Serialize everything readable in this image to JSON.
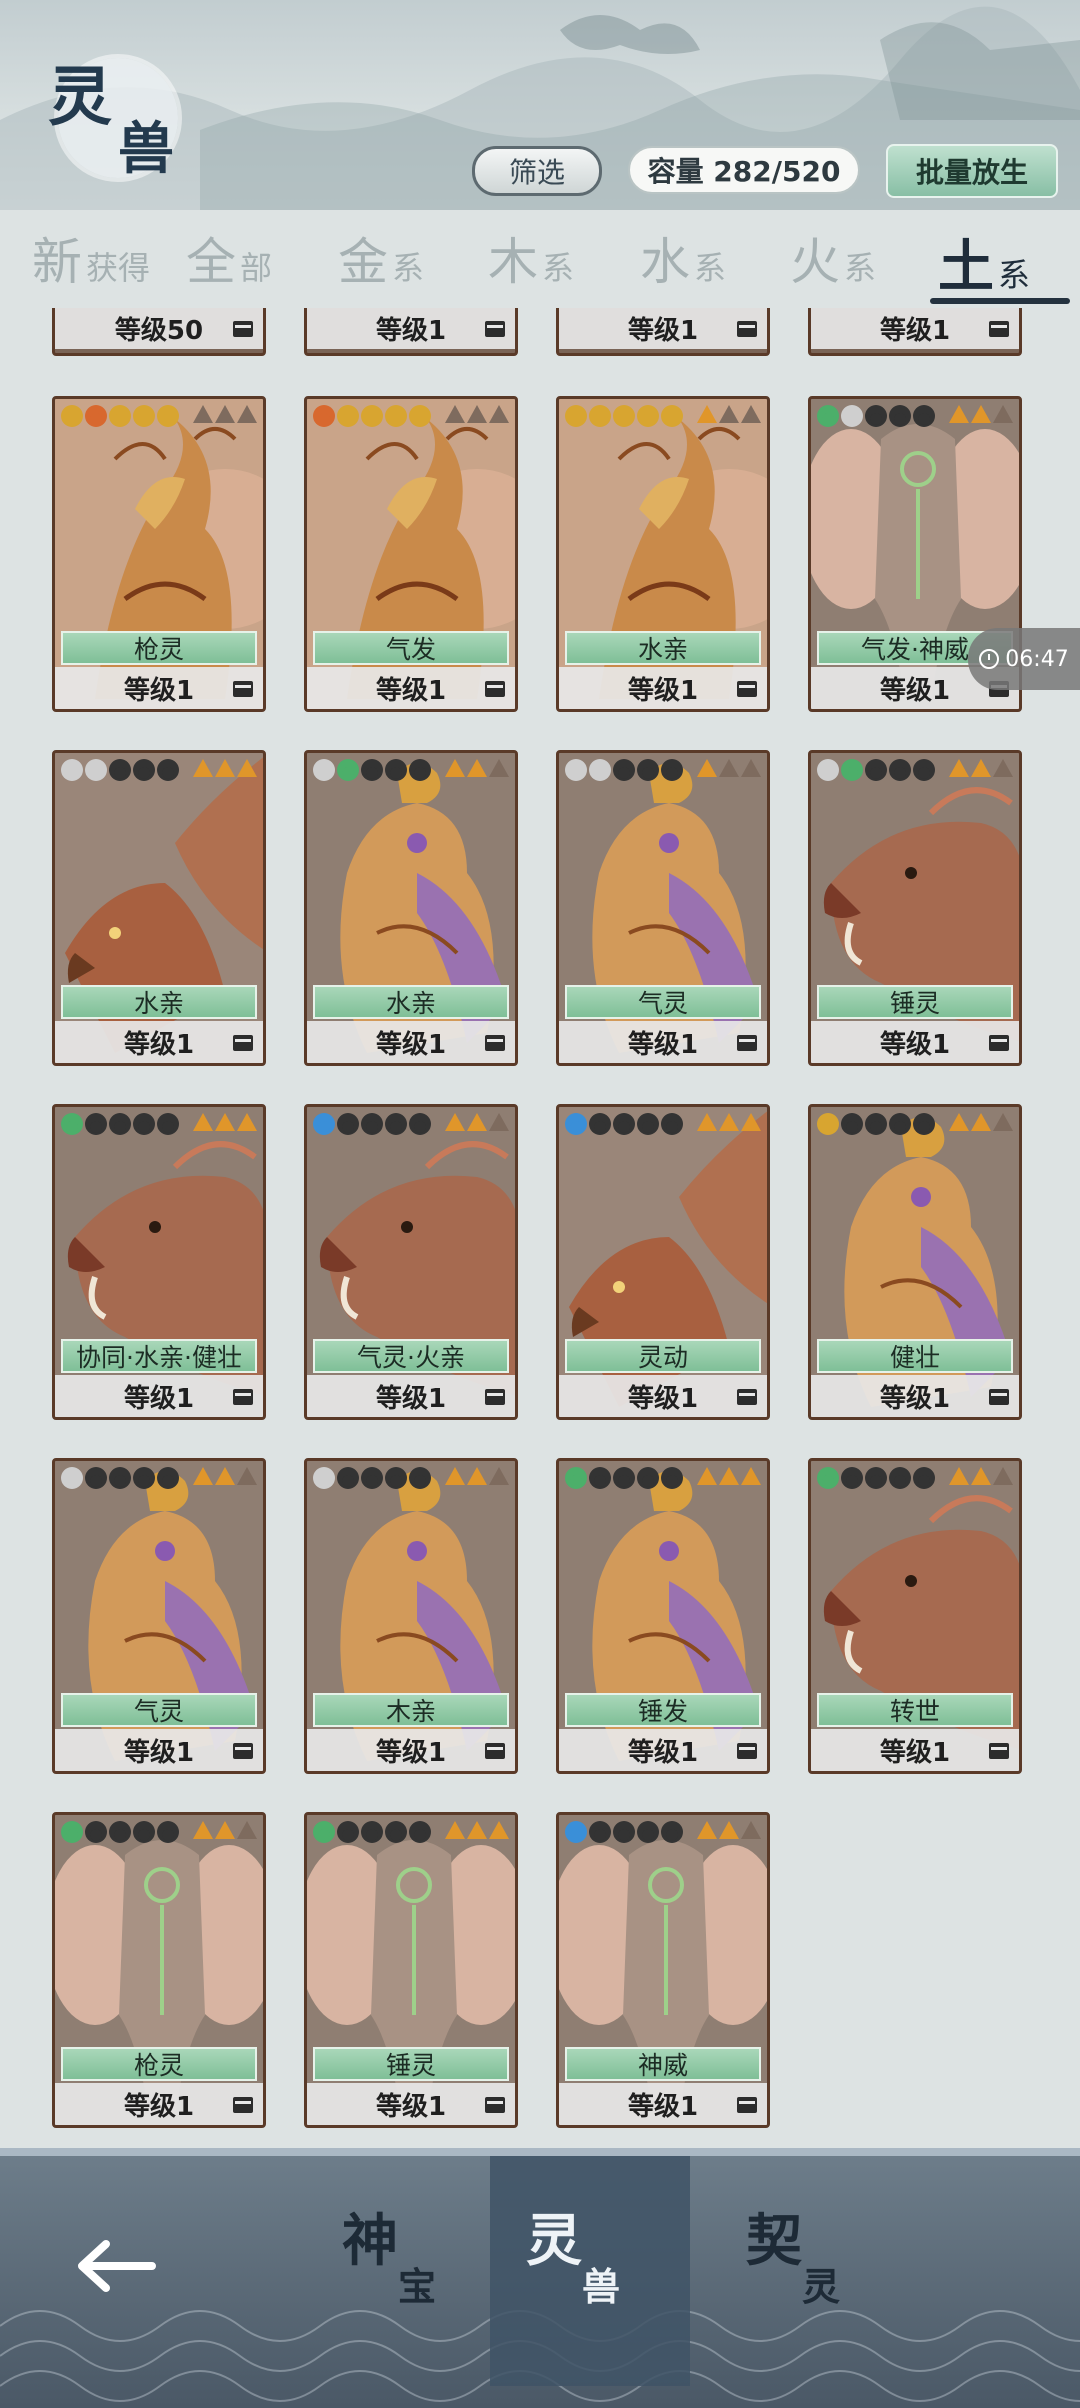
{
  "header": {
    "logo_char1": "灵",
    "logo_char2": "兽",
    "filter_label": "筛选",
    "capacity_label": "容量 282/520",
    "release_label": "批量放生"
  },
  "tabs": [
    {
      "big": "新",
      "small": "获得"
    },
    {
      "big": "全",
      "small": "部"
    },
    {
      "big": "金",
      "small": "系"
    },
    {
      "big": "木",
      "small": "系"
    },
    {
      "big": "水",
      "small": "系"
    },
    {
      "big": "火",
      "small": "系"
    },
    {
      "big": "土",
      "small": "系",
      "active": true
    }
  ],
  "top_partial_levels": [
    "等级50",
    "等级1",
    "等级1",
    "等级1"
  ],
  "cards": [
    {
      "creature": "dragon",
      "trait": "枪灵",
      "level": "等级1",
      "paws": [
        "#d8a530",
        "#d8682e",
        "#d8a530",
        "#d8a530",
        "#d8a530"
      ],
      "tris": 0
    },
    {
      "creature": "dragon",
      "trait": "气发",
      "level": "等级1",
      "paws": [
        "#d8682e",
        "#d8a530",
        "#d8a530",
        "#d8a530",
        "#d8a530"
      ],
      "tris": 0
    },
    {
      "creature": "dragon",
      "trait": "水亲",
      "level": "等级1",
      "paws": [
        "#d8a530",
        "#d8a530",
        "#d8a530",
        "#d8a530",
        "#d8a530"
      ],
      "tris": 1
    },
    {
      "creature": "elephant",
      "trait": "气发·神威",
      "level": "等级1",
      "paws": [
        "#4caf6a",
        "#cfcfcf",
        "#333",
        "#333",
        "#333"
      ],
      "tris": 2
    },
    {
      "creature": "eagle",
      "trait": "水亲",
      "level": "等级1",
      "paws": [
        "#cfcfcf",
        "#cfcfcf",
        "#333",
        "#333",
        "#333"
      ],
      "tris": 3
    },
    {
      "creature": "rooster",
      "trait": "水亲",
      "level": "等级1",
      "paws": [
        "#cfcfcf",
        "#4caf6a",
        "#333",
        "#333",
        "#333"
      ],
      "tris": 2
    },
    {
      "creature": "rooster",
      "trait": "气灵",
      "level": "等级1",
      "paws": [
        "#cfcfcf",
        "#cfcfcf",
        "#333",
        "#333",
        "#333"
      ],
      "tris": 1
    },
    {
      "creature": "boar",
      "trait": "锤灵",
      "level": "等级1",
      "paws": [
        "#cfcfcf",
        "#4caf6a",
        "#333",
        "#333",
        "#333"
      ],
      "tris": 2
    },
    {
      "creature": "boar",
      "trait": "协同·水亲·健壮",
      "level": "等级1",
      "paws": [
        "#4caf6a",
        "#333",
        "#333",
        "#333",
        "#333"
      ],
      "tris": 3
    },
    {
      "creature": "boar",
      "trait": "气灵·火亲",
      "level": "等级1",
      "paws": [
        "#3a8fd8",
        "#333",
        "#333",
        "#333",
        "#333"
      ],
      "tris": 2
    },
    {
      "creature": "eagle",
      "trait": "灵动",
      "level": "等级1",
      "paws": [
        "#3a8fd8",
        "#333",
        "#333",
        "#333",
        "#333"
      ],
      "tris": 3
    },
    {
      "creature": "rooster",
      "trait": "健壮",
      "level": "等级1",
      "paws": [
        "#d8a530",
        "#333",
        "#333",
        "#333",
        "#333"
      ],
      "tris": 2
    },
    {
      "creature": "rooster",
      "trait": "气灵",
      "level": "等级1",
      "paws": [
        "#cfcfcf",
        "#333",
        "#333",
        "#333",
        "#333"
      ],
      "tris": 2
    },
    {
      "creature": "rooster",
      "trait": "木亲",
      "level": "等级1",
      "paws": [
        "#cfcfcf",
        "#333",
        "#333",
        "#333",
        "#333"
      ],
      "tris": 2
    },
    {
      "creature": "rooster",
      "trait": "锤发",
      "level": "等级1",
      "paws": [
        "#4caf6a",
        "#333",
        "#333",
        "#333",
        "#333"
      ],
      "tris": 3
    },
    {
      "creature": "boar",
      "trait": "转世",
      "level": "等级1",
      "paws": [
        "#4caf6a",
        "#333",
        "#333",
        "#333",
        "#333"
      ],
      "tris": 2
    },
    {
      "creature": "elephant",
      "trait": "枪灵",
      "level": "等级1",
      "paws": [
        "#4caf6a",
        "#333",
        "#333",
        "#333",
        "#333"
      ],
      "tris": 2
    },
    {
      "creature": "elephant",
      "trait": "锤灵",
      "level": "等级1",
      "paws": [
        "#4caf6a",
        "#333",
        "#333",
        "#333",
        "#333"
      ],
      "tris": 3
    },
    {
      "creature": "elephant",
      "trait": "神威",
      "level": "等级1",
      "paws": [
        "#3a8fd8",
        "#333",
        "#333",
        "#333",
        "#333"
      ],
      "tris": 2
    }
  ],
  "time_bubble": "06:47",
  "bottom_nav": [
    {
      "big": "神",
      "small": "宝"
    },
    {
      "big": "灵",
      "small": "兽",
      "active": true
    },
    {
      "big": "契",
      "small": "灵"
    }
  ],
  "icons": {
    "back": "left-arrow-icon",
    "clock": "clock-icon",
    "lock": "lock-icon"
  }
}
